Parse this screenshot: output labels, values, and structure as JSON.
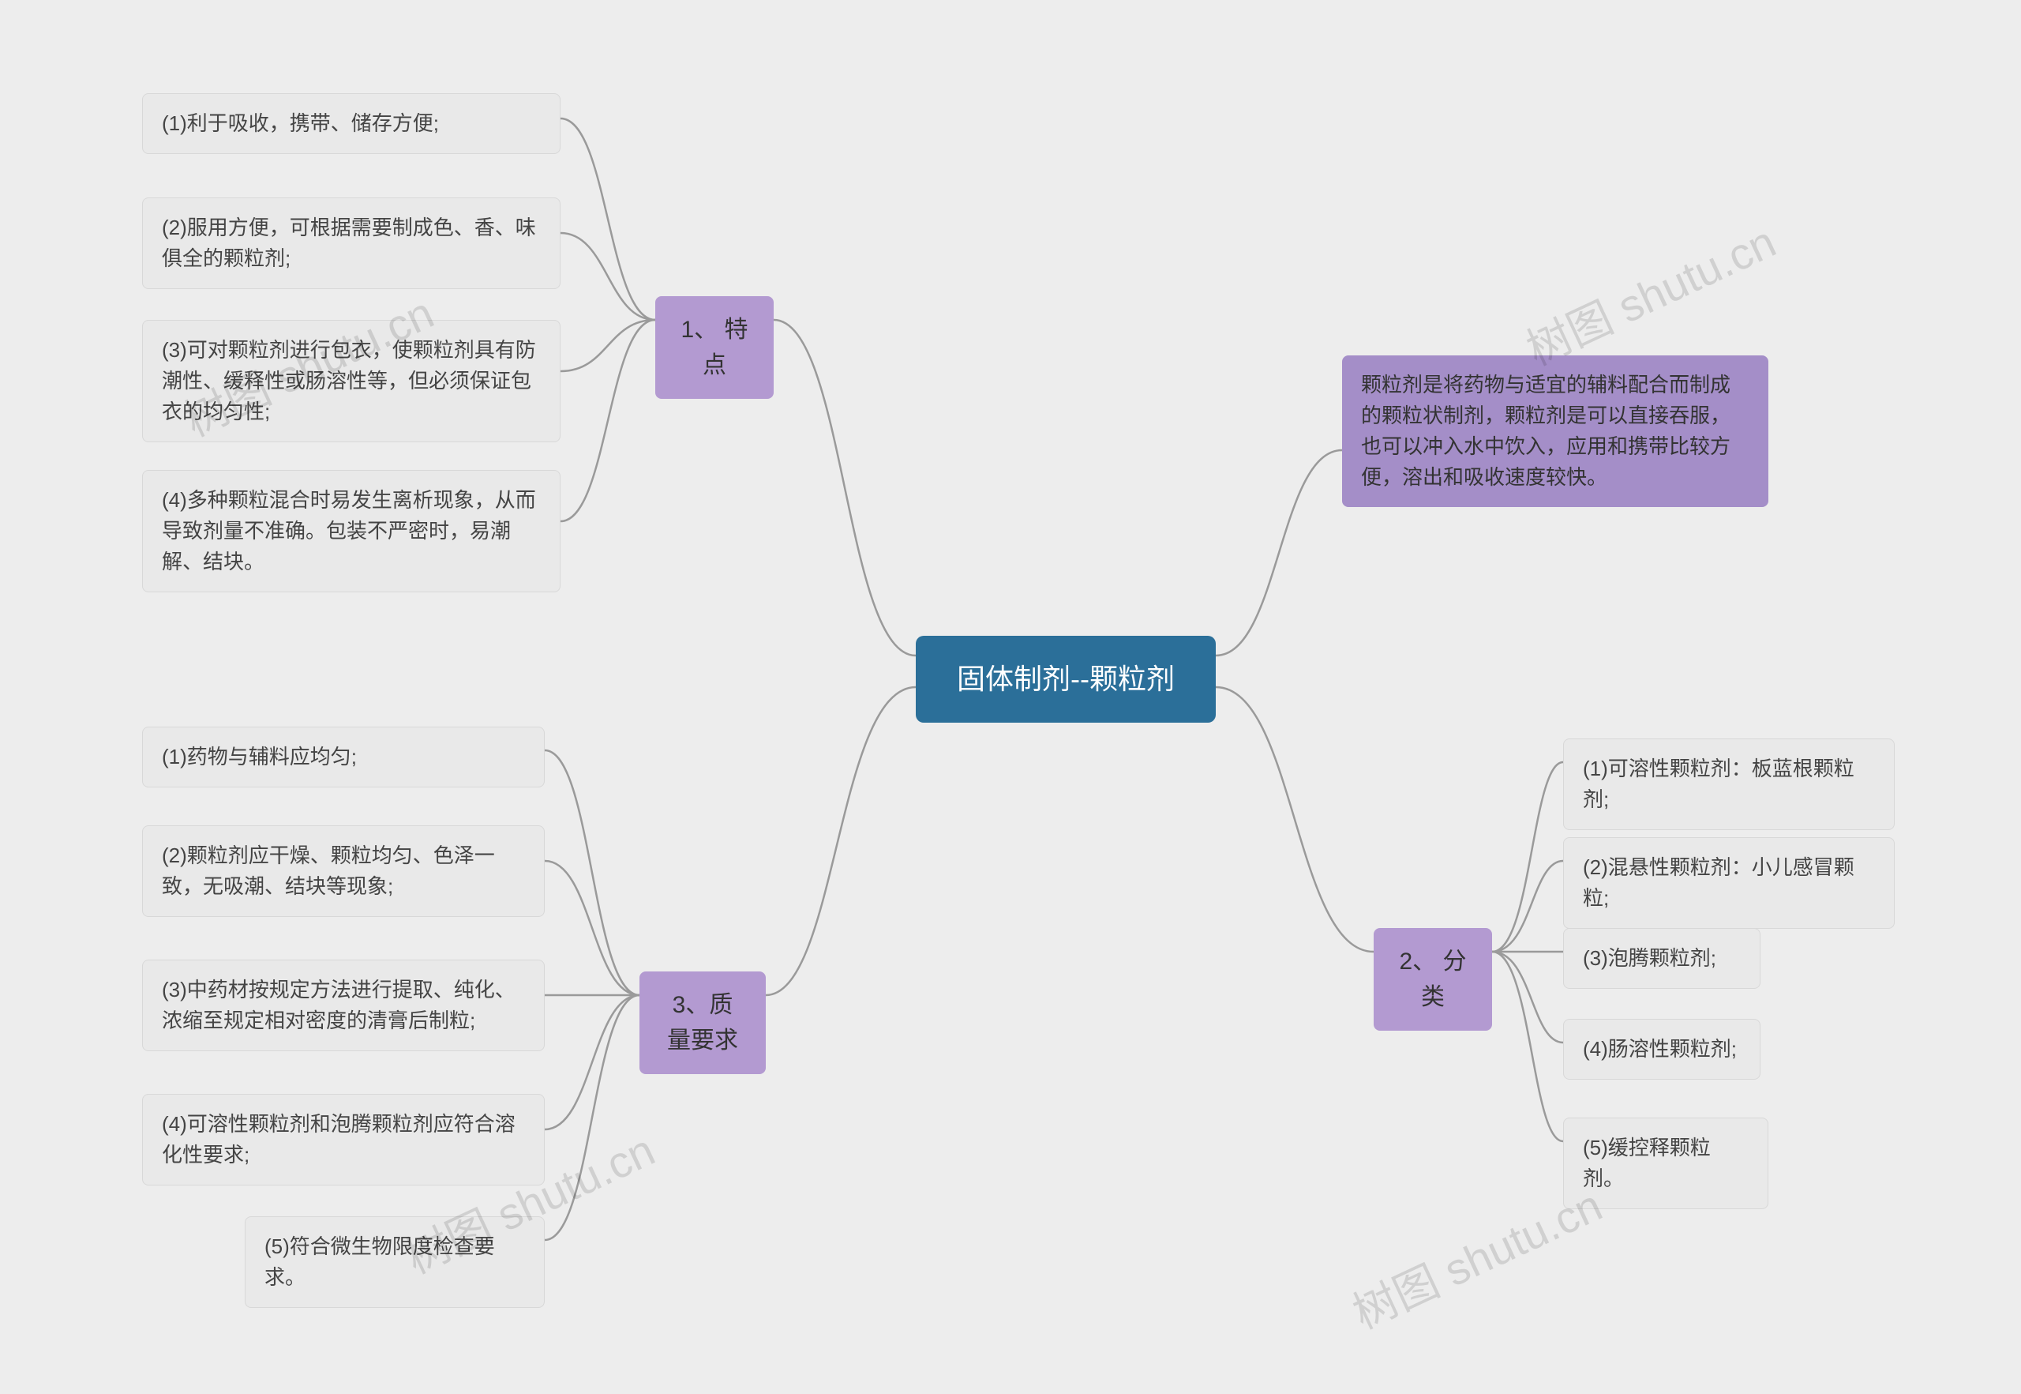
{
  "root": {
    "title": "固体制剂--颗粒剂"
  },
  "description": "颗粒剂是将药物与适宜的辅料配合而制成的颗粒状制剂，颗粒剂是可以直接吞服，也可以冲入水中饮入，应用和携带比较方便，溶出和吸收速度较快。",
  "branch1": {
    "label": "1、 特点",
    "items": [
      "(1)利于吸收，携带、储存方便;",
      "(2)服用方便，可根据需要制成色、香、味俱全的颗粒剂;",
      "(3)可对颗粒剂进行包衣，使颗粒剂具有防潮性、缓释性或肠溶性等，但必须保证包衣的均匀性;",
      "(4)多种颗粒混合时易发生离析现象，从而导致剂量不准确。包装不严密时，易潮解、结块。"
    ]
  },
  "branch2": {
    "label": "2、 分类",
    "items": [
      "(1)可溶性颗粒剂：板蓝根颗粒剂;",
      "(2)混悬性颗粒剂：小儿感冒颗粒;",
      "(3)泡腾颗粒剂;",
      "(4)肠溶性颗粒剂;",
      "(5)缓控释颗粒剂。"
    ]
  },
  "branch3": {
    "label": "3、质量要求",
    "items": [
      "(1)药物与辅料应均匀;",
      "(2)颗粒剂应干燥、颗粒均匀、色泽一致，无吸潮、结块等现象;",
      "(3)中药材按规定方法进行提取、纯化、浓缩至规定相对密度的清膏后制粒;",
      "(4)可溶性颗粒剂和泡腾颗粒剂应符合溶化性要求;",
      "(5)符合微生物限度检查要求。"
    ]
  },
  "watermark": "树图 shutu.cn"
}
